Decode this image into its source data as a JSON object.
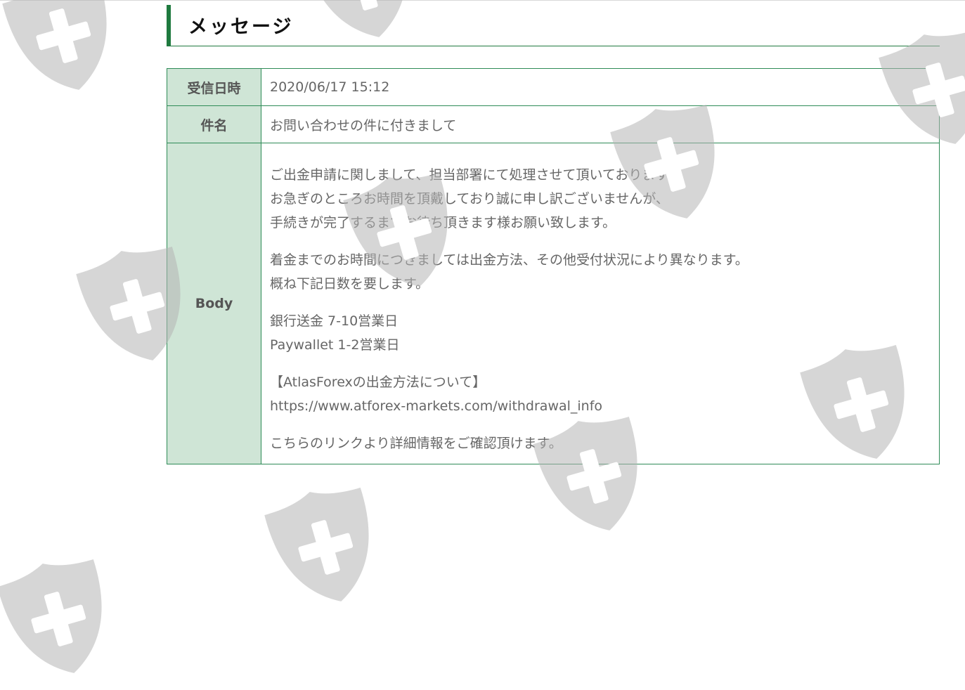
{
  "page": {
    "heading": "メッセージ"
  },
  "message": {
    "received_label": "受信日時",
    "received_value": "2020/06/17 15:12",
    "subject_label": "件名",
    "subject_value": "お問い合わせの件に付きまして",
    "body_label": "Body",
    "body_paragraphs": [
      [
        "ご出金申請に関しまして、担当部署にて処理させて頂いております。",
        "お急ぎのところお時間を頂戴しており誠に申し訳ございませんが、",
        "手続きが完了するまでお待ち頂きます様お願い致します。"
      ],
      [
        "着金までのお時間につきましては出金方法、その他受付状況により異なります。",
        "概ね下記日数を要します。"
      ],
      [
        "銀行送金 7-10営業日",
        "Paywallet 1-2営業日"
      ],
      [
        "【AtlasForexの出金方法について】",
        "https://www.atforex-markets.com/withdrawal_info"
      ],
      [
        "こちらのリンクより詳細情報をご確認頂けます。"
      ]
    ]
  },
  "watermark": {
    "icon": "shield-plus-icon",
    "color": "#b4b4b4"
  },
  "colors": {
    "accent": "#1f7a3f",
    "border": "#2e8b57",
    "label_bg": "#cfe5d6"
  }
}
